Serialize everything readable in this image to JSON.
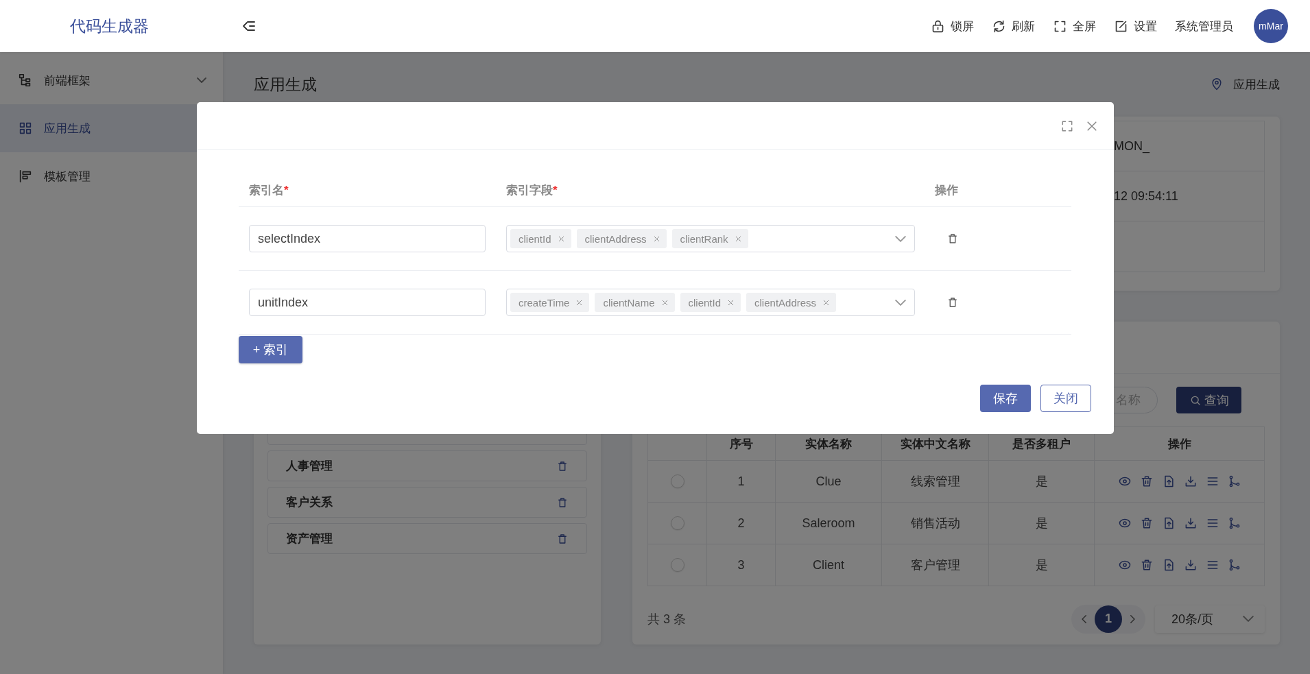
{
  "header": {
    "logo": "代码生成器",
    "actions": [
      {
        "kind": "lock",
        "label": "锁屏"
      },
      {
        "kind": "refresh",
        "label": "刷新"
      },
      {
        "kind": "fullscreen",
        "label": "全屏"
      },
      {
        "kind": "settings",
        "label": "设置"
      }
    ],
    "user": "系统管理员",
    "avatar": "mMar"
  },
  "sidebar": {
    "items": [
      {
        "kind": "tree",
        "label": "前端框架",
        "selected": false,
        "expanded": false
      },
      {
        "kind": "grid",
        "label": "应用生成",
        "selected": true
      },
      {
        "kind": "template",
        "label": "模板管理",
        "selected": false
      }
    ]
  },
  "page": {
    "title": "应用生成",
    "breadcrumb": "应用生成"
  },
  "info_card": {
    "values": [
      "MON_",
      "12 09:54:11"
    ]
  },
  "module_list": {
    "items": [
      {
        "label": "人事管理"
      },
      {
        "label": "客户关系"
      },
      {
        "label": "资产管理"
      }
    ]
  },
  "entity_table": {
    "search_placeholder": "名称",
    "search_button": "查询",
    "columns": [
      "序号",
      "实体名称",
      "实体中文名称",
      "是否多租户",
      "操作"
    ],
    "rows": [
      {
        "selected": false,
        "cells": [
          "1",
          "Clue",
          "线索管理",
          "是"
        ]
      },
      {
        "selected": false,
        "cells": [
          "2",
          "Saleroom",
          "销售活动",
          "是"
        ]
      },
      {
        "selected": false,
        "cells": [
          "3",
          "Client",
          "客户管理",
          "是"
        ]
      }
    ],
    "total": "共 3 条",
    "pages": [
      {
        "label": "1",
        "selected": true
      }
    ],
    "page_size": "20条/页"
  },
  "dialog": {
    "columns": [
      {
        "label": "索引名",
        "required_mark": "*"
      },
      {
        "label": "索引字段",
        "required_mark": "*"
      },
      {
        "label": "操作"
      }
    ],
    "rows": [
      {
        "name": "selectIndex",
        "fields": [
          "clientId",
          "clientAddress",
          "clientRank"
        ]
      },
      {
        "name": "unitIndex",
        "fields": [
          "createTime",
          "clientName",
          "clientId",
          "clientAddress"
        ]
      }
    ],
    "add_button": "+ 索引",
    "buttons": [
      {
        "kind": "primary",
        "label": "保存"
      },
      {
        "kind": "default",
        "label": "关闭"
      }
    ]
  }
}
